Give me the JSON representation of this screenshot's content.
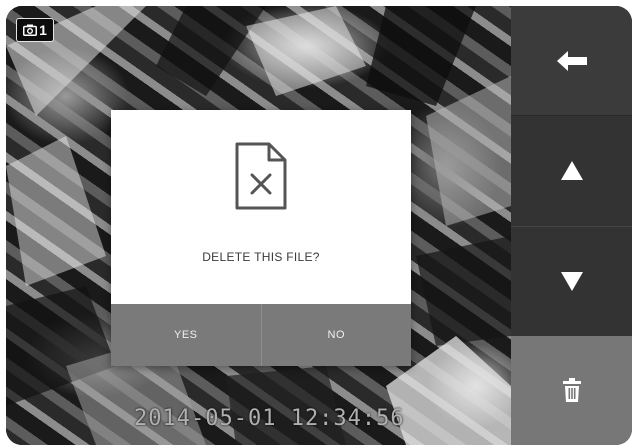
{
  "overlay": {
    "camera_number": "1",
    "timestamp": "2014-05-01 12:34:56"
  },
  "dialog": {
    "icon": "deleted-file-icon",
    "message": "DELETE THIS FILE?",
    "yes_label": "YES",
    "no_label": "NO"
  },
  "side_panel": {
    "back_icon": "back-arrow-icon",
    "up_icon": "up-triangle-icon",
    "down_icon": "down-triangle-icon",
    "delete_icon": "trash-icon"
  },
  "colors": {
    "dialog_background": "#ffffff",
    "dialog_buttons": "#7a7a7a",
    "side_panel": "#333333",
    "delete_button": "#777777",
    "message_text": "#3a3a3a"
  }
}
